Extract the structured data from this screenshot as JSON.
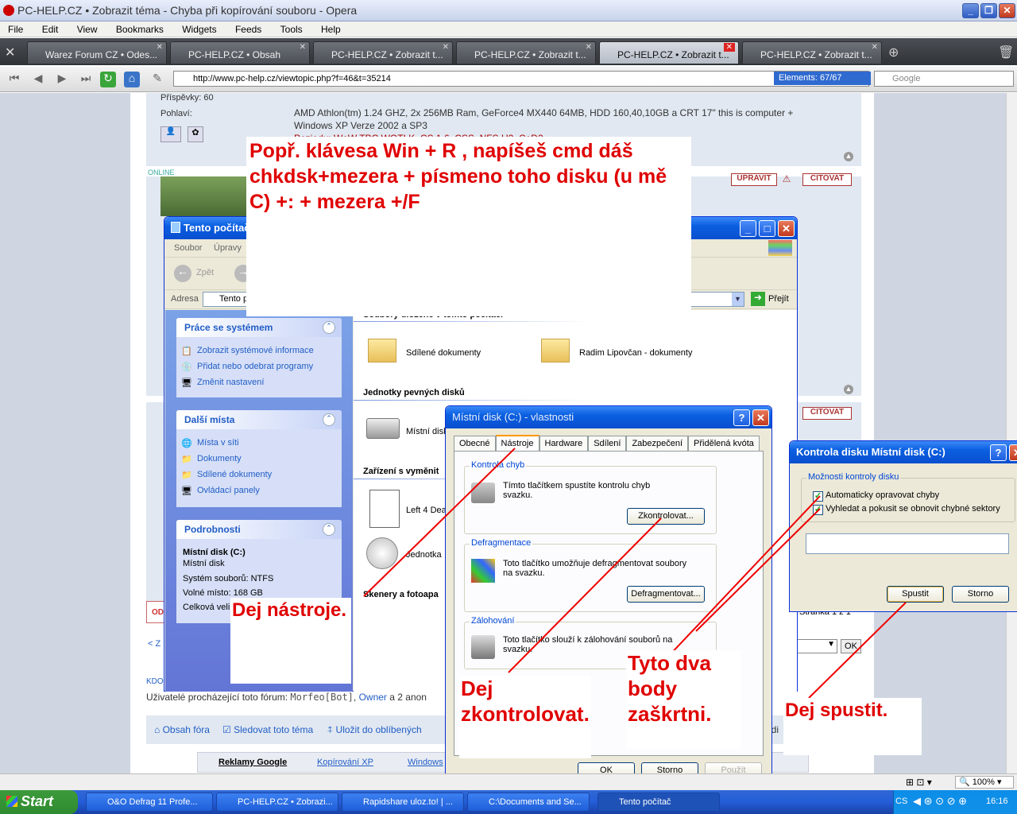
{
  "browser": {
    "title": "PC-HELP.CZ • Zobrazit téma - Chyba při kopírování souboru - Opera",
    "menu": [
      "File",
      "Edit",
      "View",
      "Bookmarks",
      "Widgets",
      "Feeds",
      "Tools",
      "Help"
    ],
    "tabs": [
      {
        "label": "Warez Forum CZ • Odes..."
      },
      {
        "label": "PC-HELP.CZ • Obsah"
      },
      {
        "label": "PC-HELP.CZ • Zobrazit t..."
      },
      {
        "label": "PC-HELP.CZ • Zobrazit t..."
      },
      {
        "label": "PC-HELP.CZ • Zobrazit t..."
      },
      {
        "label": "PC-HELP.CZ • Zobrazit t..."
      }
    ],
    "url": "http://www.pc-help.cz/viewtopic.php?f=46&t=35214",
    "elements": "Elements:  67/67",
    "search_placeholder": "Google",
    "zoom": "100%"
  },
  "forum": {
    "posts_label": "Příspěvky: 60",
    "gender_label": "Pohlaví:",
    "sig1": "AMD Athlon(tm) 1.24 GHZ, 2x 256MB Ram, GeForce4 MX440 64MB, HDD 160,40,10GB a CRT 17\" this is computer +",
    "sig2": "Windows XP Verze 2002 a SP3",
    "sig3": "Pozjedu: WoW TBC WOTLK, CS 1.6, CSS, NFS U2, CoD2",
    "online": "ONLINE",
    "upravit": "UPRAVIT",
    "citovat": "CITOVAT",
    "citovat2": "CITOVAT",
    "stranka": "Stránka 1 z 1",
    "ok": "OK",
    "users_label": "Uživatelé procházející toto fórum:",
    "user1": "Morfeo[Bot]",
    "user2": "Owner",
    "users_rest": "a 2 anon",
    "kdo": "KDO",
    "obsah": "Obsah fóra",
    "sledovat": "Sledovat toto téma",
    "ulozit": "Uložit do oblíbených",
    "reklamy": "Reklamy Google",
    "kopirovani": "Kopírování XP",
    "windows": "Windows",
    "prev": "< Z",
    "od": "OD",
    "odi": "odi",
    "zero": "0"
  },
  "explorer": {
    "title": "Tento počítač",
    "menu": [
      "Soubor",
      "Úpravy"
    ],
    "back": "Zpět",
    "address_label": "Adresa",
    "address_value": "Tento p",
    "go": "Přejít",
    "sections": {
      "files": "Soubory uložené v tomto počítači",
      "hdd": "Jednotky pevných disků",
      "removable": "Zařízení s vyměnit",
      "scanners": "Skenery a fotoapa"
    },
    "items": {
      "shared": "Sdílené dokumenty",
      "radim": "Radim Lipovčan - dokumenty",
      "disk": "Místní disk",
      "left4": "Left 4 Dea",
      "cd": "Jednotka"
    },
    "tasks": {
      "title": "Práce se systémem",
      "items": [
        "Zobrazit systémové informace",
        "Přidat nebo odebrat programy",
        "Změnit nastavení"
      ]
    },
    "places": {
      "title": "Další místa",
      "items": [
        "Místa v síti",
        "Dokumenty",
        "Sdílené dokumenty",
        "Ovládací panely"
      ]
    },
    "details": {
      "title": "Podrobnosti",
      "name": "Místní disk (C:)",
      "type": "Místní disk",
      "fs": "Systém souborů: NTFS",
      "free": "Volné místo: 168 GB",
      "total": "Celková veli"
    }
  },
  "props": {
    "title": "Místní disk (C:) - vlastnosti",
    "tabs": [
      "Obecné",
      "Nástroje",
      "Hardware",
      "Sdílení",
      "Zabezpečení",
      "Přidělená kvóta"
    ],
    "check": {
      "label": "Kontrola chyb",
      "text": "Tímto tlačítkem spustíte kontrolu chyb svazku.",
      "button": "Zkontrolovat..."
    },
    "defrag": {
      "label": "Defragmentace",
      "text": "Toto tlačítko umožňuje defragmentovat soubory na svazku.",
      "button": "Defragmentovat..."
    },
    "backup": {
      "label": "Zálohování",
      "text": "Toto tlačítko slouží k zálohování souborů na svazku."
    },
    "ok": "OK",
    "cancel": "Storno",
    "apply": "Použít"
  },
  "chkdsk": {
    "title": "Kontrola disku Místní disk (C:)",
    "group": "Možnosti kontroly disku",
    "opt1": "Automaticky opravovat chyby",
    "opt2": "Vyhledat a pokusit se obnovit chybné sektory",
    "start": "Spustit",
    "cancel": "Storno"
  },
  "annotations": {
    "top": "Popř. klávesa Win + R , napíšeš cmd dáš chkdsk+mezera + písmeno toho disku (u mě C) +: + mezera +/F",
    "tools": "Dej nástroje.",
    "check": "Dej zkontrolovat.",
    "tick": "Tyto dva body zaškrtni.",
    "run": "Dej spustit."
  },
  "taskbar": {
    "start": "Start",
    "tasks": [
      "O&O Defrag 11 Profe...",
      "PC-HELP.CZ • Zobrazi...",
      "Rapidshare uloz.to! | ...",
      "C:\\Documents and Se...",
      "Tento počítač"
    ],
    "lang": "CS",
    "time": "16:16"
  }
}
